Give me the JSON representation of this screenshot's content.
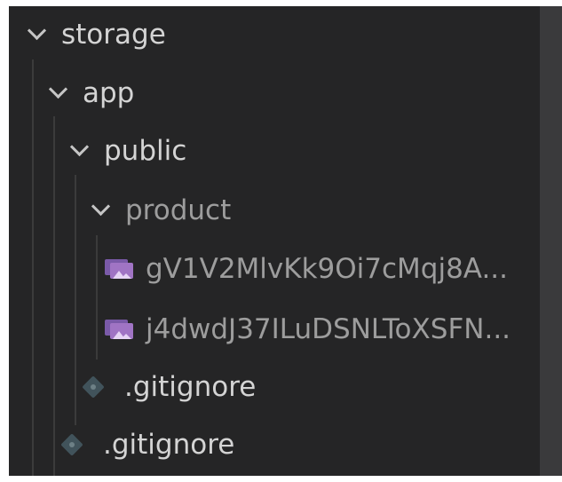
{
  "explorer": {
    "tree": [
      {
        "type": "folder",
        "label": "storage",
        "expanded": true,
        "depth": 0
      },
      {
        "type": "folder",
        "label": "app",
        "expanded": true,
        "depth": 1
      },
      {
        "type": "folder",
        "label": "public",
        "expanded": true,
        "depth": 2
      },
      {
        "type": "folder",
        "label": "product",
        "expanded": true,
        "depth": 3,
        "muted": true
      },
      {
        "type": "image-file",
        "label": "gV1V2MlvKk9Oi7cMqj8A...",
        "depth": 4,
        "icon": "image-icon"
      },
      {
        "type": "image-file",
        "label": "j4dwdJ37ILuDSNLToXSFN...",
        "depth": 4,
        "icon": "image-icon"
      },
      {
        "type": "git-file",
        "label": ".gitignore",
        "depth": 3,
        "icon": "git-icon"
      },
      {
        "type": "git-file",
        "label": ".gitignore",
        "depth": 2,
        "icon": "git-icon"
      }
    ]
  },
  "colors": {
    "panel_background": "#252526",
    "scrollbar": "#3a3a3c",
    "text": "#d4d4d4",
    "muted_text": "#9d9d9d",
    "image_icon": "#a074c4",
    "git_icon": "#41535b"
  }
}
